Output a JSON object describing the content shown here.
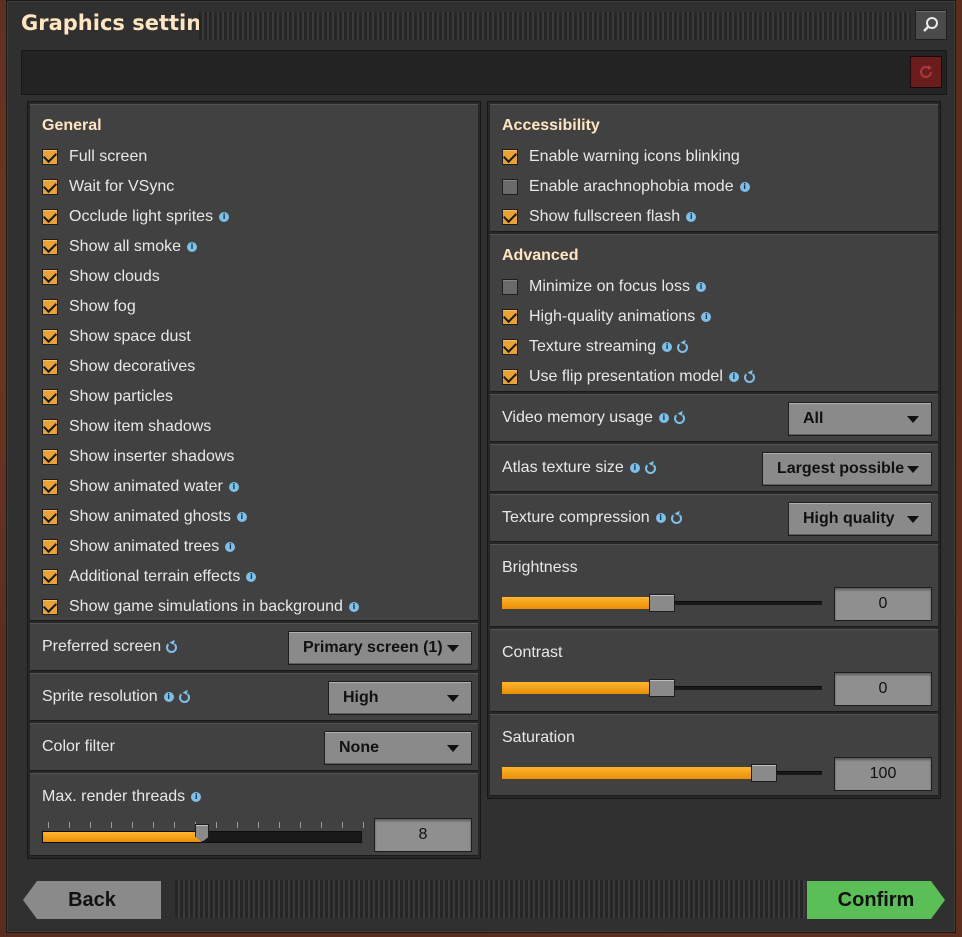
{
  "window": {
    "title": "Graphics settings"
  },
  "general": {
    "title": "General",
    "items": [
      {
        "label": "Full screen",
        "checked": true,
        "info": false
      },
      {
        "label": "Wait for VSync",
        "checked": true,
        "info": false
      },
      {
        "label": "Occlude light sprites",
        "checked": true,
        "info": true
      },
      {
        "label": "Show all smoke",
        "checked": true,
        "info": true
      },
      {
        "label": "Show clouds",
        "checked": true,
        "info": false
      },
      {
        "label": "Show fog",
        "checked": true,
        "info": false
      },
      {
        "label": "Show space dust",
        "checked": true,
        "info": false
      },
      {
        "label": "Show decoratives",
        "checked": true,
        "info": false
      },
      {
        "label": "Show particles",
        "checked": true,
        "info": false
      },
      {
        "label": "Show item shadows",
        "checked": true,
        "info": false
      },
      {
        "label": "Show inserter shadows",
        "checked": true,
        "info": false
      },
      {
        "label": "Show animated water",
        "checked": true,
        "info": true
      },
      {
        "label": "Show animated ghosts",
        "checked": true,
        "info": true
      },
      {
        "label": "Show animated trees",
        "checked": true,
        "info": true
      },
      {
        "label": "Additional terrain effects",
        "checked": true,
        "info": true
      },
      {
        "label": "Show game simulations in background",
        "checked": true,
        "info": true
      }
    ]
  },
  "left_settings": {
    "preferred_screen": {
      "label": "Preferred screen",
      "value": "Primary screen (1)"
    },
    "sprite_resolution": {
      "label": "Sprite resolution",
      "value": "High"
    },
    "color_filter": {
      "label": "Color filter",
      "value": "None"
    },
    "max_render_threads": {
      "label": "Max. render threads",
      "value": "8",
      "level": 8,
      "max": 16
    }
  },
  "accessibility": {
    "title": "Accessibility",
    "items": [
      {
        "label": "Enable warning icons blinking",
        "checked": true,
        "info": false
      },
      {
        "label": "Enable arachnophobia mode",
        "checked": false,
        "info": true
      },
      {
        "label": "Show fullscreen flash",
        "checked": true,
        "info": true
      }
    ]
  },
  "advanced": {
    "title": "Advanced",
    "items": [
      {
        "label": "Minimize on focus loss",
        "checked": false,
        "info": true,
        "restart": false
      },
      {
        "label": "High-quality animations",
        "checked": true,
        "info": true,
        "restart": false
      },
      {
        "label": "Texture streaming",
        "checked": true,
        "info": true,
        "restart": true
      },
      {
        "label": "Use flip presentation model",
        "checked": true,
        "info": true,
        "restart": true
      }
    ]
  },
  "right_settings": {
    "video_memory": {
      "label": "Video memory usage",
      "value": "All"
    },
    "atlas_texture": {
      "label": "Atlas texture size",
      "value": "Largest possible"
    },
    "texture_compression": {
      "label": "Texture compression",
      "value": "High quality"
    },
    "brightness": {
      "label": "Brightness",
      "value": "0",
      "level_fraction": 0.5
    },
    "contrast": {
      "label": "Contrast",
      "value": "0",
      "level_fraction": 0.5
    },
    "saturation": {
      "label": "Saturation",
      "value": "100",
      "level_fraction": 0.82
    }
  },
  "footer": {
    "back": "Back",
    "confirm": "Confirm"
  },
  "colors": {
    "accent": "#e8a235",
    "confirm": "#5bbf58",
    "info": "#7ec0e8",
    "title": "#ffe6c0"
  },
  "icons": [
    "search-icon",
    "reset-icon",
    "info-icon",
    "restart-icon",
    "chevron-down-icon"
  ]
}
